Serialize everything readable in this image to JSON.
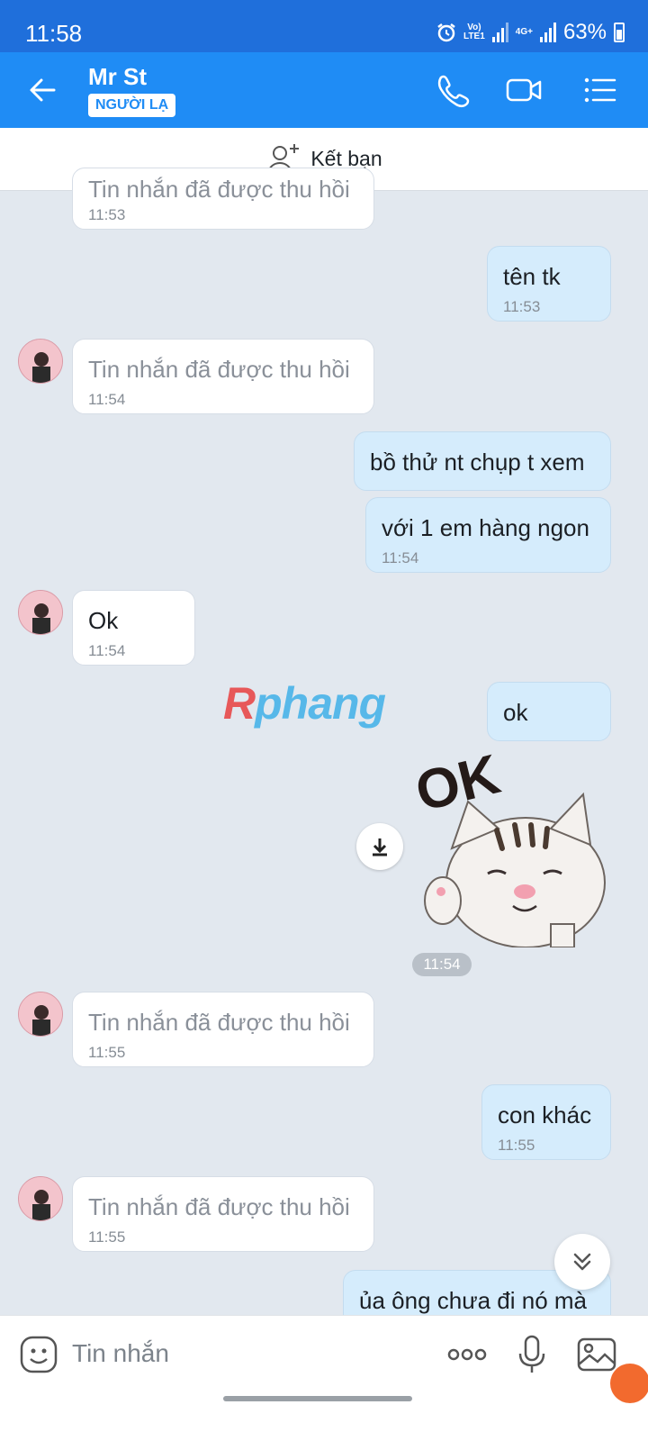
{
  "status_bar": {
    "time": "11:58",
    "volte_label": "Vo)\nLTE1",
    "net_label": "4G+",
    "battery": "63%"
  },
  "header": {
    "name": "Mr St",
    "badge": "NGƯỜI LẠ"
  },
  "friend_bar": {
    "label": "Kết bạn"
  },
  "watermark": {
    "first": "R",
    "rest": "phang"
  },
  "messages": [
    {
      "text": "Tin nhắn đã được thu hồi",
      "time": "11:53"
    },
    {
      "text": "tên tk",
      "time": "11:53"
    },
    {
      "text": "Tin nhắn đã được thu hồi",
      "time": "11:54"
    },
    {
      "text": "bồ thử nt chụp t xem"
    },
    {
      "text": "với 1 em hàng ngon",
      "time": "11:54"
    },
    {
      "text": "Ok",
      "time": "11:54"
    },
    {
      "text": "ok"
    },
    {
      "sticker_text": "OK",
      "time": "11:54"
    },
    {
      "text": "Tin nhắn đã được thu hồi",
      "time": "11:55"
    },
    {
      "text": "con khác",
      "time": "11:55"
    },
    {
      "text": "Tin nhắn đã được thu hồi",
      "time": "11:55"
    },
    {
      "text": "ủa ông chưa đi nó mà"
    }
  ],
  "input": {
    "placeholder": "Tin nhắn"
  },
  "colors": {
    "header": "#1f8cf5",
    "status_bar": "#1f6fdb",
    "outgoing_bubble": "#d5ecfc",
    "chat_bg": "#e2e8ef"
  }
}
